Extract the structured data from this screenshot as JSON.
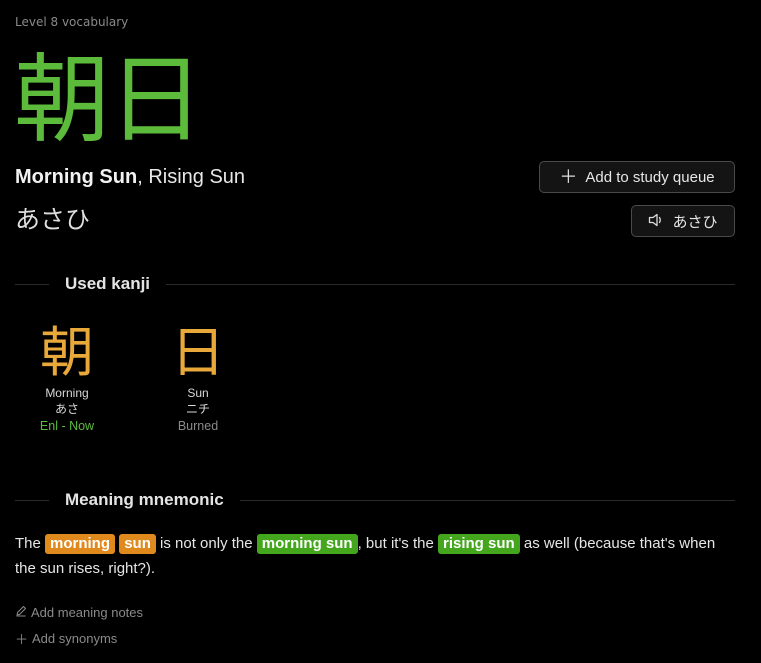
{
  "header": {
    "level_label": "Level 8 vocabulary",
    "kanji": "朝日",
    "primary_meaning": "Morning Sun",
    "separator": ", ",
    "alt_meaning": "Rising Sun",
    "reading": "あさひ"
  },
  "actions": {
    "add_queue_icon": "plus-icon",
    "add_queue_label": "Add to study queue",
    "audio_icon": "speaker-icon",
    "audio_label": "あさひ"
  },
  "used_kanji": {
    "title": "Used kanji",
    "items": [
      {
        "kanji": "朝",
        "meaning": "Morning",
        "reading": "あさ",
        "status": "Enl - Now"
      },
      {
        "kanji": "日",
        "meaning": "Sun",
        "reading": "ニチ",
        "status": "Burned"
      }
    ]
  },
  "mnemonic": {
    "title": "Meaning mnemonic",
    "t1": "The ",
    "h1": "morning",
    "h2": "sun",
    "t2": " is not only the ",
    "h3": "morning sun",
    "t3": ", but it's the ",
    "h4": "rising sun",
    "t4": " as well (because that's when the sun rises, right?)."
  },
  "notes": {
    "meaning_icon": "pencil-icon",
    "meaning_label": "Add meaning notes",
    "synonyms_icon": "plus-icon",
    "synonyms_label": "Add synonyms"
  },
  "colors": {
    "vocab_green": "#5dbb3c",
    "kanji_gold": "#e8a93a",
    "radical_orange": "#e08a1e",
    "vocab_highlight": "#43a61c"
  }
}
